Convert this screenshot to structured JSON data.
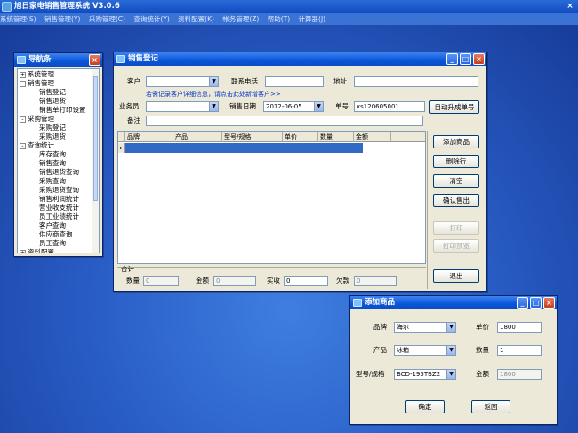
{
  "app": {
    "title": "旭日家电销售管理系统  V3.0.6",
    "close": "×"
  },
  "menu": [
    "系统管理(S)",
    "销售管理(Y)",
    "采购管理(C)",
    "查询统计(Y)",
    "资料配置(K)",
    "帐务管理(Z)",
    "帮助(T)",
    "计算器(J)"
  ],
  "nav": {
    "title": "导航条",
    "items": [
      {
        "label": "系统管理",
        "level": 0,
        "toggle": "+"
      },
      {
        "label": "销售管理",
        "level": 0,
        "toggle": "-"
      },
      {
        "label": "销售登记",
        "level": 1
      },
      {
        "label": "销售退货",
        "level": 1
      },
      {
        "label": "销售单打印设置",
        "level": 1
      },
      {
        "label": "采购管理",
        "level": 0,
        "toggle": "-"
      },
      {
        "label": "采购登记",
        "level": 1
      },
      {
        "label": "采购退货",
        "level": 1
      },
      {
        "label": "查询统计",
        "level": 0,
        "toggle": "-"
      },
      {
        "label": "库存查询",
        "level": 1
      },
      {
        "label": "销售查询",
        "level": 1
      },
      {
        "label": "销售退货查询",
        "level": 1
      },
      {
        "label": "采购查询",
        "level": 1
      },
      {
        "label": "采购退货查询",
        "level": 1
      },
      {
        "label": "销售利润统计",
        "level": 1
      },
      {
        "label": "营业收支统计",
        "level": 1
      },
      {
        "label": "员工业绩统计",
        "level": 1
      },
      {
        "label": "客户查询",
        "level": 1
      },
      {
        "label": "供应商查询",
        "level": 1
      },
      {
        "label": "员工查询",
        "level": 1
      },
      {
        "label": "资料配置",
        "level": 0,
        "toggle": "+"
      }
    ]
  },
  "sales": {
    "title": "销售登记",
    "customer_label": "客户",
    "phone_label": "联系电话",
    "address_label": "地址",
    "hint_link": "若需记录客户详细信息，请点击此处新增客户>>",
    "staff_label": "业务员",
    "date_label": "销售日期",
    "date_value": "2012-06-05",
    "order_label": "单号",
    "order_value": "xs120605001",
    "auto_order_button": "自动升成单号",
    "remark_label": "备注",
    "columns": [
      "品牌",
      "产品",
      "型号/规格",
      "单价",
      "数量",
      "金额"
    ],
    "buttons": {
      "add": "添加商品",
      "delete": "删除行",
      "clear": "清空",
      "confirm": "确认售出",
      "print": "打印",
      "print_preview": "打印预览",
      "exit": "退出"
    },
    "totals": {
      "group_label": "合计",
      "qty_label": "数量",
      "qty_value": "0",
      "amount_label": "金额",
      "amount_value": "0",
      "paid_label": "实收",
      "paid_value": "0",
      "owed_label": "欠款",
      "owed_value": "0"
    }
  },
  "add_product": {
    "title": "添加商品",
    "brand_label": "品牌",
    "brand_value": "海尔",
    "price_label": "单价",
    "price_value": "1800",
    "product_label": "产品",
    "product_value": "冰箱",
    "qty_label": "数量",
    "qty_value": "1",
    "model_label": "型号/规格",
    "model_value": "BCD-195TBZ2",
    "amount_label": "金额",
    "amount_value": "1800",
    "ok_button": "确定",
    "back_button": "返回"
  },
  "colors": {
    "titlebar": "#0a55d8",
    "window_bg": "#ece9d8",
    "selection": "#316ac5",
    "link": "#0033cc"
  }
}
